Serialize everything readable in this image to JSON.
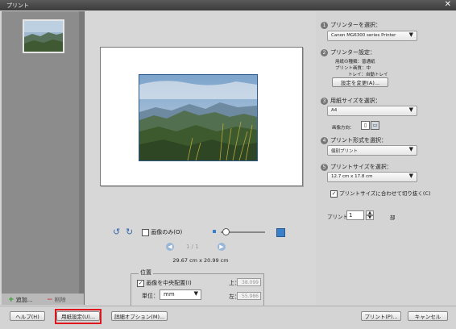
{
  "window": {
    "title": "プリント",
    "close": "✕"
  },
  "left_panel": {
    "add_label": "追加...",
    "remove_label": "削除"
  },
  "preview": {
    "image_only_label": "画像のみ(O)",
    "page_indicator": "1 / 1",
    "dimensions": "29.67 cm x 20.99 cm",
    "position": {
      "title": "位置",
      "center_label": "画像を中央配置(I)",
      "unit_label": "単位：",
      "unit_value": "mm",
      "top_label": "上：",
      "top_value": "38.099",
      "left_label": "左：",
      "left_value": "55.986"
    }
  },
  "settings": {
    "step1": {
      "num": "1",
      "label": "プリンターを選択：",
      "value": "Canon MG6300 series Printer"
    },
    "step2": {
      "num": "2",
      "label": "プリンター設定：",
      "paper_type": "用紙の種類：普通紙",
      "print_quality": "プリント画質：中",
      "tray": "トレイ：自動トレイ",
      "change_button": "設定を変更(A)..."
    },
    "step3": {
      "num": "3",
      "label": "用紙サイズを選択：",
      "value": "A4",
      "orientation_label": "画像方向："
    },
    "step4": {
      "num": "4",
      "label": "プリント形式を選択：",
      "value": "個別プリント"
    },
    "step5": {
      "num": "5",
      "label": "プリントサイズを選択：",
      "value": "12.7 cm x 17.8 cm",
      "crop_label": "プリントサイズに合わせて切り抜く(C)"
    },
    "copies": {
      "label": "プリント",
      "value": "1",
      "unit": "部"
    }
  },
  "footer": {
    "help": "ヘルプ(H)",
    "page_setup": "用紙設定(U)...",
    "more_options": "詳細オプション(M)...",
    "print": "プリント(P)...",
    "cancel": "キャンセル"
  },
  "colors": {
    "accent": "#3a7fc7",
    "highlight": "#e0161e",
    "step_circle": "#777777"
  }
}
